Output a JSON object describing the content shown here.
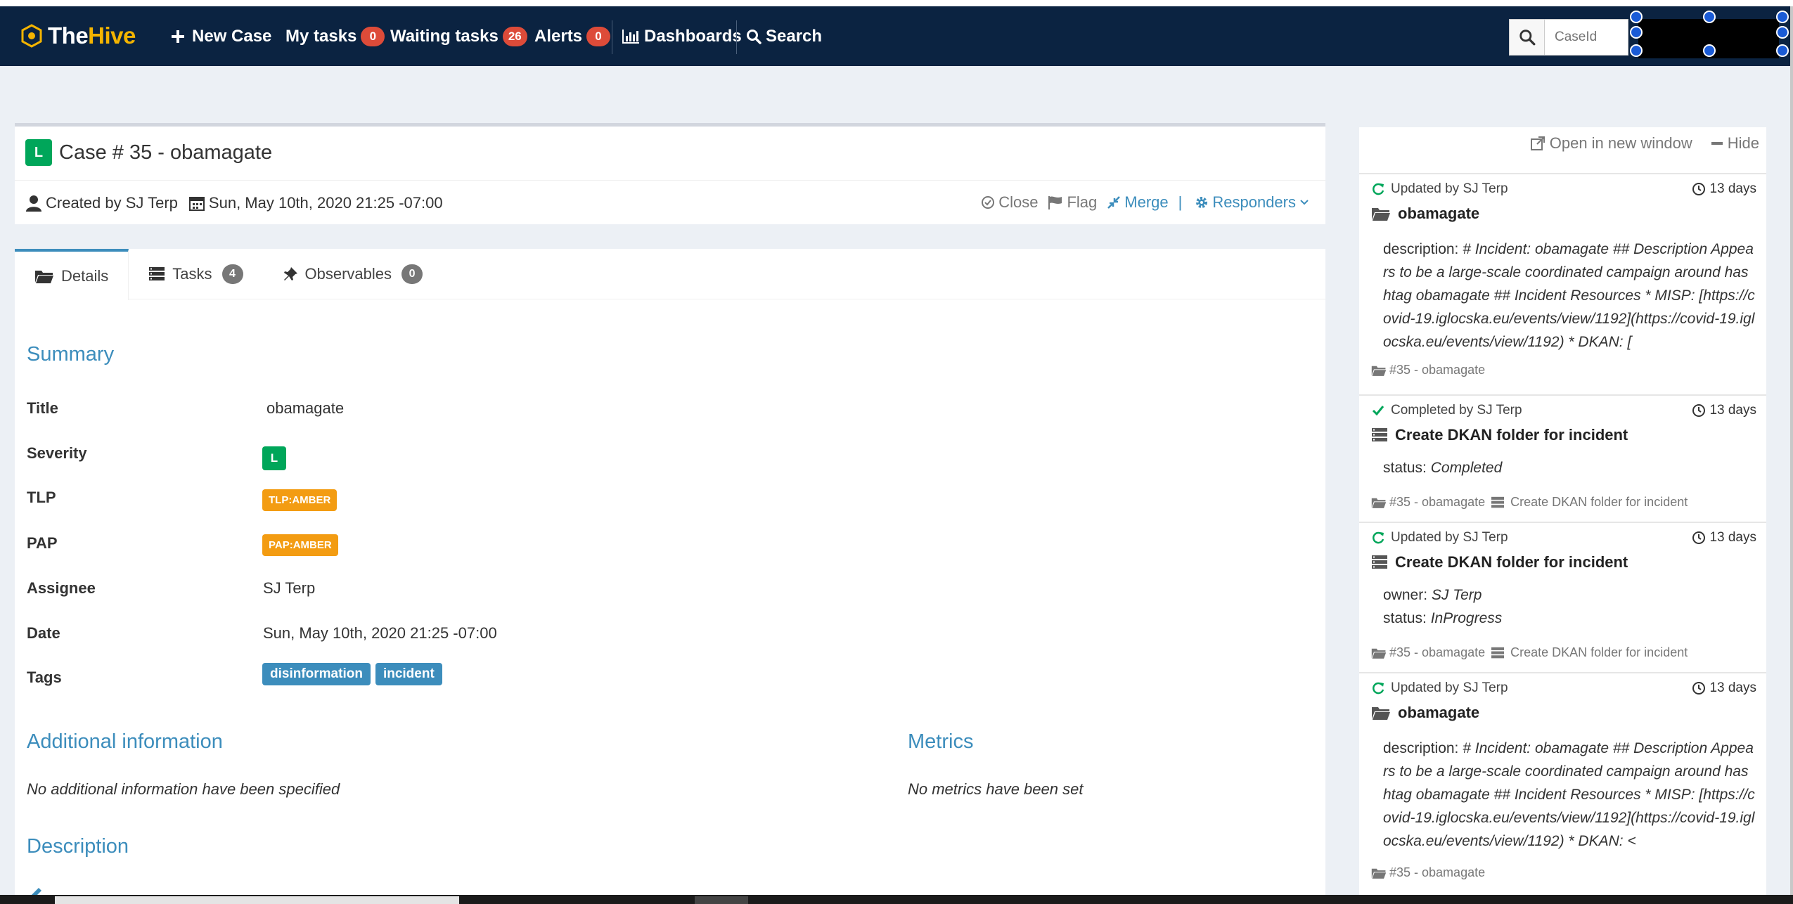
{
  "app": {
    "brand_the": "The",
    "brand_hive": "Hive"
  },
  "nav": {
    "new_case": "New Case",
    "my_tasks": "My tasks",
    "my_tasks_count": "0",
    "waiting_tasks": "Waiting tasks",
    "waiting_tasks_count": "26",
    "alerts": "Alerts",
    "alerts_count": "0",
    "dashboards": "Dashboards",
    "search": "Search",
    "search_placeholder": "CaseId"
  },
  "case": {
    "severity": "L",
    "title": "Case # 35 - obamagate",
    "created_by": "Created by SJ Terp",
    "created_date": "Sun, May 10th, 2020 21:25 -07:00",
    "actions": {
      "close": "Close",
      "flag": "Flag",
      "merge": "Merge",
      "separator": "|",
      "responders": "Responders"
    }
  },
  "tabs": [
    {
      "label": "Details"
    },
    {
      "label": "Tasks",
      "count": "4"
    },
    {
      "label": "Observables",
      "count": "0"
    }
  ],
  "details": {
    "summary_heading": "Summary",
    "fields": {
      "title_label": "Title",
      "title_value": "obamagate",
      "severity_label": "Severity",
      "severity_value": "L",
      "tlp_label": "TLP",
      "tlp_value": "TLP:AMBER",
      "pap_label": "PAP",
      "pap_value": "PAP:AMBER",
      "assignee_label": "Assignee",
      "assignee_value": "SJ Terp",
      "date_label": "Date",
      "date_value": "Sun, May 10th, 2020 21:25 -07:00",
      "tags_label": "Tags",
      "tags": [
        "disinformation",
        "incident"
      ]
    },
    "additional_heading": "Additional information",
    "additional_text": "No additional information have been specified",
    "metrics_heading": "Metrics",
    "metrics_text": "No metrics have been set",
    "description_heading": "Description"
  },
  "flow": {
    "open_new_window": "Open in new window",
    "hide": "Hide",
    "entries": [
      {
        "action": "Updated by SJ Terp",
        "time": "13 days",
        "object": "obamagate",
        "body_key": "description:",
        "body_val": "# Incident: obamagate ## Description Appears to be a large-scale coordinated campaign around hashtag obamagate ## Incident Resources * MISP: [https://covid-19.iglocska.eu/events/view/1192](https://covid-19.iglocska.eu/events/view/1192) * DKAN: [",
        "foot_case": "#35 - obamagate"
      },
      {
        "action": "Completed by SJ Terp",
        "time": "13 days",
        "object": "Create DKAN folder for incident",
        "status_key": "status:",
        "status_val": "Completed",
        "foot_case": "#35 - obamagate",
        "foot_task": "Create DKAN folder for incident"
      },
      {
        "action": "Updated by SJ Terp",
        "time": "13 days",
        "object": "Create DKAN folder for incident",
        "owner_key": "owner:",
        "owner_val": "SJ Terp",
        "status_key": "status:",
        "status_val": "InProgress",
        "foot_case": "#35 - obamagate",
        "foot_task": "Create DKAN folder for incident"
      },
      {
        "action": "Updated by SJ Terp",
        "time": "13 days",
        "object": "obamagate",
        "body_key": "description:",
        "body_val": "# Incident: obamagate ## Description Appears to be a large-scale coordinated campaign around hashtag obamagate ## Incident Resources * MISP: [https://covid-19.iglocska.eu/events/view/1192](https://covid-19.iglocska.eu/events/view/1192) * DKAN: <",
        "foot_case": "#35 - obamagate"
      }
    ]
  },
  "colors": {
    "navbar": "#0b2341",
    "accent": "#3c8dbc",
    "severity_low": "#00a65a",
    "amber": "#f39c12",
    "badge_red": "#dd4b39"
  }
}
